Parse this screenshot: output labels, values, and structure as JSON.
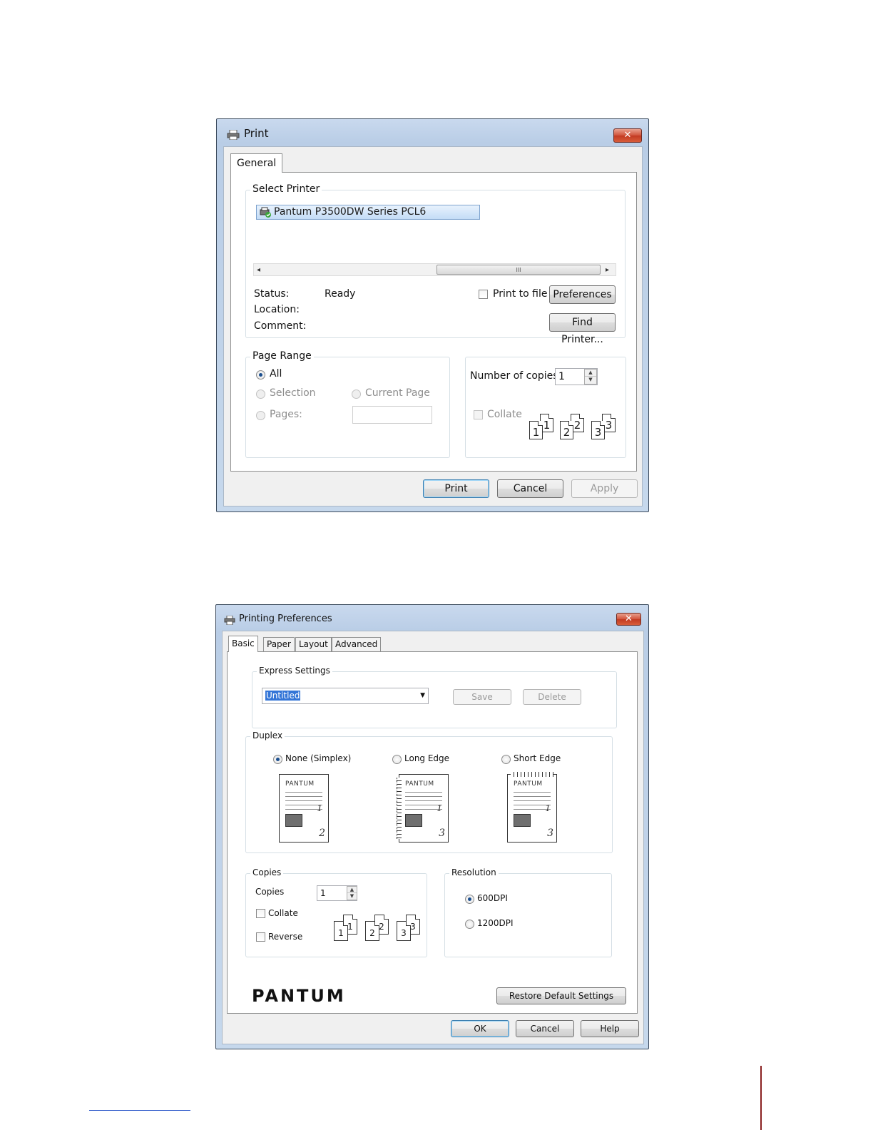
{
  "print_dialog": {
    "title": "Print",
    "close_glyph": "✕",
    "tabs": [
      "General"
    ],
    "select_printer": {
      "label": "Select Printer",
      "printer_name": "Pantum P3500DW Series PCL6",
      "scroll_thumb": "III"
    },
    "status_label": "Status:",
    "status_value": "Ready",
    "location_label": "Location:",
    "comment_label": "Comment:",
    "print_to_file": "Print to file",
    "preferences_btn": "Preferences",
    "find_printer_btn": "Find Printer...",
    "page_range": {
      "label": "Page Range",
      "all": "All",
      "selection": "Selection",
      "current_page": "Current Page",
      "pages": "Pages:",
      "pages_value": ""
    },
    "copies": {
      "number_label": "Number of copies:",
      "value": "1",
      "collate": "Collate",
      "icons": [
        "1",
        "1",
        "2",
        "2",
        "3",
        "3"
      ]
    },
    "buttons": {
      "print": "Print",
      "cancel": "Cancel",
      "apply": "Apply"
    }
  },
  "prefs_dialog": {
    "title": "Printing Preferences",
    "close_glyph": "✕",
    "tabs": [
      "Basic",
      "Paper",
      "Layout",
      "Advanced"
    ],
    "express": {
      "label": "Express Settings",
      "value": "Untitled",
      "save": "Save",
      "delete": "Delete"
    },
    "duplex": {
      "label": "Duplex",
      "none": "None (Simplex)",
      "long": "Long Edge",
      "short": "Short Edge",
      "doc_brand": "PANTUM",
      "doc_page1": "1",
      "doc_page2": "2",
      "doc_page3": "3"
    },
    "copies": {
      "label": "Copies",
      "copies_label": "Copies",
      "value": "1",
      "collate": "Collate",
      "reverse": "Reverse",
      "icons": [
        "1",
        "1",
        "2",
        "2",
        "3",
        "3"
      ]
    },
    "resolution": {
      "label": "Resolution",
      "r600": "600DPI",
      "r1200": "1200DPI"
    },
    "logo": "PANTUM",
    "restore": "Restore Default Settings",
    "buttons": {
      "ok": "OK",
      "cancel": "Cancel",
      "help": "Help"
    }
  }
}
